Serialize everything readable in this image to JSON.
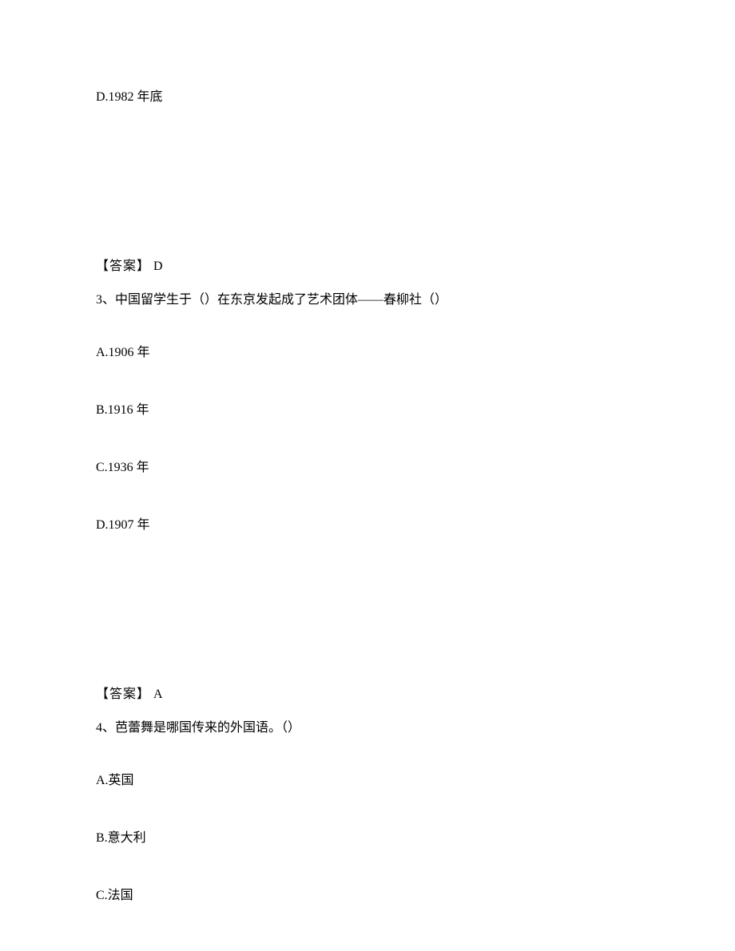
{
  "q2": {
    "optionD": "D.1982 年底",
    "answerLabel": "【答案】",
    "answerValue": " D"
  },
  "q3": {
    "stem": "3、中国留学生于（）在东京发起成了艺术团体——春柳社（）",
    "optionA": "A.1906 年",
    "optionB": "B.1916 年",
    "optionC": "C.1936 年",
    "optionD": "D.1907 年",
    "answerLabel": "【答案】",
    "answerValue": " A"
  },
  "q4": {
    "stem": "4、芭蕾舞是哪国传来的外国语。（）",
    "optionA": "A.英国",
    "optionB": "B.意大利",
    "optionC": "C.法国"
  }
}
